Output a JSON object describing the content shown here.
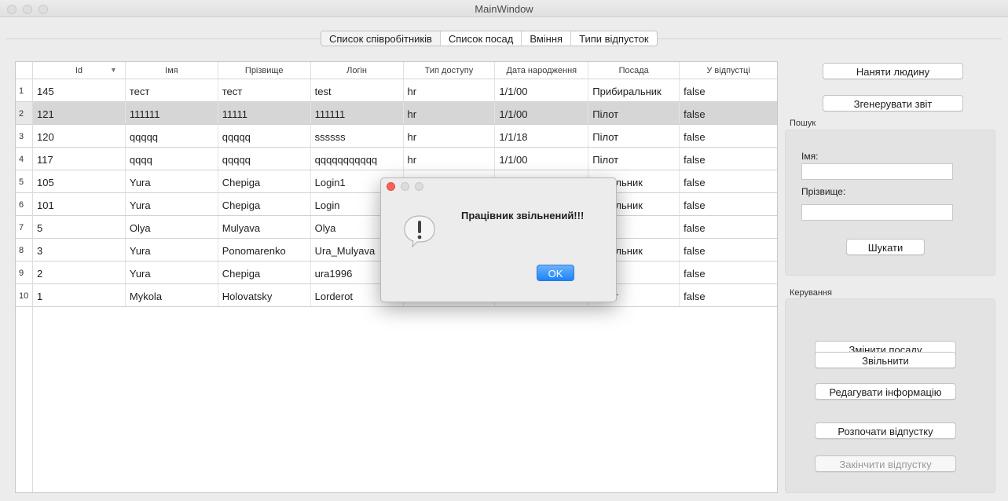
{
  "window": {
    "title": "MainWindow"
  },
  "tabs": [
    {
      "label": "Список співробітників",
      "active": true
    },
    {
      "label": "Список посад",
      "active": false
    },
    {
      "label": "Вміння",
      "active": false
    },
    {
      "label": "Типи відпусток",
      "active": false
    }
  ],
  "table": {
    "columns": [
      "Id",
      "Імя",
      "Прізвище",
      "Логін",
      "Тип доступу",
      "Дата народження",
      "Посада",
      "У відпустці"
    ],
    "sort_column": "Id",
    "selected_row": 2,
    "rows": [
      {
        "num": "1",
        "cells": [
          "145",
          "тест",
          "тест",
          "test",
          "hr",
          "1/1/00",
          "Прибиральник",
          "false"
        ]
      },
      {
        "num": "2",
        "cells": [
          "121",
          "111111",
          "11111",
          "111111",
          "hr",
          "1/1/00",
          "Пілот",
          "false"
        ]
      },
      {
        "num": "3",
        "cells": [
          "120",
          "qqqqq",
          "qqqqq",
          "ssssss",
          "hr",
          "1/1/18",
          "Пілот",
          "false"
        ]
      },
      {
        "num": "4",
        "cells": [
          "117",
          "qqqq",
          "qqqqq",
          "qqqqqqqqqqq",
          "hr",
          "1/1/00",
          "Пілот",
          "false"
        ]
      },
      {
        "num": "5",
        "cells": [
          "105",
          "Yura",
          "Chepiga",
          "Login1",
          "",
          "",
          "биральник",
          "false"
        ]
      },
      {
        "num": "6",
        "cells": [
          "101",
          "Yura",
          "Chepiga",
          "Login",
          "",
          "",
          "биральник",
          "false"
        ]
      },
      {
        "num": "7",
        "cells": [
          "5",
          "Olya",
          "Mulyava",
          "Olya",
          "",
          "",
          "т",
          "false"
        ]
      },
      {
        "num": "8",
        "cells": [
          "3",
          "Yura",
          "Ponomarenko",
          "Ura_Mulyava",
          "",
          "",
          "биральник",
          "false"
        ]
      },
      {
        "num": "9",
        "cells": [
          "2",
          "Yura",
          "Chepiga",
          "ura1996",
          "",
          "",
          "ютер",
          "false"
        ]
      },
      {
        "num": "10",
        "cells": [
          "1",
          "Mykola",
          "Holovatsky",
          "Lorderot",
          "manager",
          "12/20/95",
          "Пілот",
          "false"
        ]
      }
    ]
  },
  "actions": {
    "hire": "Наняти людину",
    "report": "Згенерувати звіт"
  },
  "search": {
    "group_label": "Пошук",
    "name_label": "Імя:",
    "name_value": "",
    "surname_label": "Прізвище:",
    "surname_value": "",
    "search_button": "Шукати"
  },
  "management": {
    "group_label": "Керування",
    "change_position": "Змінити посаду",
    "fire": "Звільнити",
    "edit_info": "Редагувати інформацію",
    "start_vacation": "Розпочати відпустку",
    "end_vacation": "Закінчити відпустку"
  },
  "dialog": {
    "message": "Працівник звільнений!!!",
    "ok_label": "OK",
    "icon": "warning-icon"
  }
}
